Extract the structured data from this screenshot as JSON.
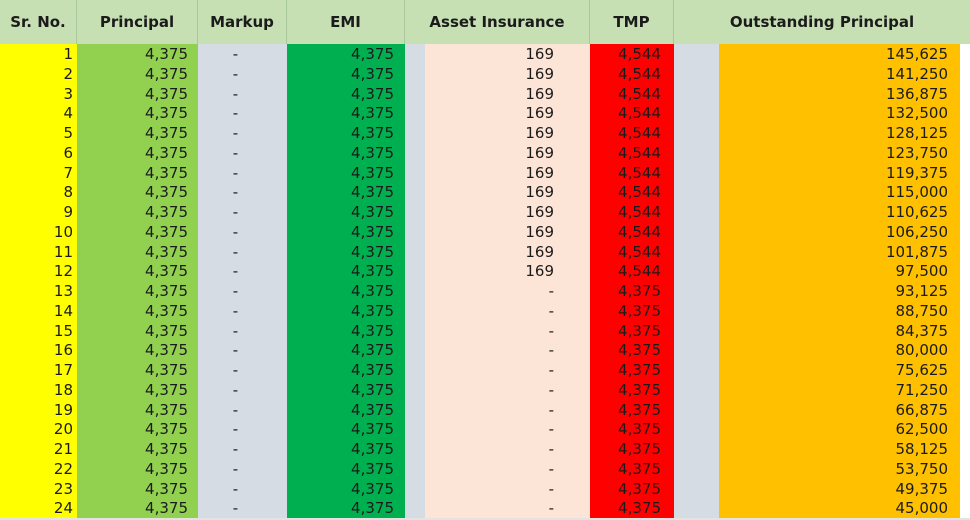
{
  "headers": {
    "sr_no": "Sr. No.",
    "principal": "Principal",
    "markup": "Markup",
    "emi": "EMI",
    "asset_insurance": "Asset Insurance",
    "tmp": "TMP",
    "outstanding_principal": "Outstanding Principal"
  },
  "colors": {
    "header_bg": "#c6e0b4",
    "sr_no_bg": "#ffff00",
    "principal_bg": "#92d050",
    "markup_bg": "#d6dce4",
    "emi_bg": "#00b050",
    "insurance_bg": "#fce4d6",
    "tmp_bg": "#ff0000",
    "outstanding_bg": "#ffc000"
  },
  "rows": [
    {
      "sr": "1",
      "principal": "4,375",
      "markup": "-",
      "emi": "4,375",
      "insurance": "169",
      "tmp": "4,544",
      "outstanding": "145,625"
    },
    {
      "sr": "2",
      "principal": "4,375",
      "markup": "-",
      "emi": "4,375",
      "insurance": "169",
      "tmp": "4,544",
      "outstanding": "141,250"
    },
    {
      "sr": "3",
      "principal": "4,375",
      "markup": "-",
      "emi": "4,375",
      "insurance": "169",
      "tmp": "4,544",
      "outstanding": "136,875"
    },
    {
      "sr": "4",
      "principal": "4,375",
      "markup": "-",
      "emi": "4,375",
      "insurance": "169",
      "tmp": "4,544",
      "outstanding": "132,500"
    },
    {
      "sr": "5",
      "principal": "4,375",
      "markup": "-",
      "emi": "4,375",
      "insurance": "169",
      "tmp": "4,544",
      "outstanding": "128,125"
    },
    {
      "sr": "6",
      "principal": "4,375",
      "markup": "-",
      "emi": "4,375",
      "insurance": "169",
      "tmp": "4,544",
      "outstanding": "123,750"
    },
    {
      "sr": "7",
      "principal": "4,375",
      "markup": "-",
      "emi": "4,375",
      "insurance": "169",
      "tmp": "4,544",
      "outstanding": "119,375"
    },
    {
      "sr": "8",
      "principal": "4,375",
      "markup": "-",
      "emi": "4,375",
      "insurance": "169",
      "tmp": "4,544",
      "outstanding": "115,000"
    },
    {
      "sr": "9",
      "principal": "4,375",
      "markup": "-",
      "emi": "4,375",
      "insurance": "169",
      "tmp": "4,544",
      "outstanding": "110,625"
    },
    {
      "sr": "10",
      "principal": "4,375",
      "markup": "-",
      "emi": "4,375",
      "insurance": "169",
      "tmp": "4,544",
      "outstanding": "106,250"
    },
    {
      "sr": "11",
      "principal": "4,375",
      "markup": "-",
      "emi": "4,375",
      "insurance": "169",
      "tmp": "4,544",
      "outstanding": "101,875"
    },
    {
      "sr": "12",
      "principal": "4,375",
      "markup": "-",
      "emi": "4,375",
      "insurance": "169",
      "tmp": "4,544",
      "outstanding": "97,500"
    },
    {
      "sr": "13",
      "principal": "4,375",
      "markup": "-",
      "emi": "4,375",
      "insurance": "-",
      "tmp": "4,375",
      "outstanding": "93,125"
    },
    {
      "sr": "14",
      "principal": "4,375",
      "markup": "-",
      "emi": "4,375",
      "insurance": "-",
      "tmp": "4,375",
      "outstanding": "88,750"
    },
    {
      "sr": "15",
      "principal": "4,375",
      "markup": "-",
      "emi": "4,375",
      "insurance": "-",
      "tmp": "4,375",
      "outstanding": "84,375"
    },
    {
      "sr": "16",
      "principal": "4,375",
      "markup": "-",
      "emi": "4,375",
      "insurance": "-",
      "tmp": "4,375",
      "outstanding": "80,000"
    },
    {
      "sr": "17",
      "principal": "4,375",
      "markup": "-",
      "emi": "4,375",
      "insurance": "-",
      "tmp": "4,375",
      "outstanding": "75,625"
    },
    {
      "sr": "18",
      "principal": "4,375",
      "markup": "-",
      "emi": "4,375",
      "insurance": "-",
      "tmp": "4,375",
      "outstanding": "71,250"
    },
    {
      "sr": "19",
      "principal": "4,375",
      "markup": "-",
      "emi": "4,375",
      "insurance": "-",
      "tmp": "4,375",
      "outstanding": "66,875"
    },
    {
      "sr": "20",
      "principal": "4,375",
      "markup": "-",
      "emi": "4,375",
      "insurance": "-",
      "tmp": "4,375",
      "outstanding": "62,500"
    },
    {
      "sr": "21",
      "principal": "4,375",
      "markup": "-",
      "emi": "4,375",
      "insurance": "-",
      "tmp": "4,375",
      "outstanding": "58,125"
    },
    {
      "sr": "22",
      "principal": "4,375",
      "markup": "-",
      "emi": "4,375",
      "insurance": "-",
      "tmp": "4,375",
      "outstanding": "53,750"
    },
    {
      "sr": "23",
      "principal": "4,375",
      "markup": "-",
      "emi": "4,375",
      "insurance": "-",
      "tmp": "4,375",
      "outstanding": "49,375"
    },
    {
      "sr": "24",
      "principal": "4,375",
      "markup": "-",
      "emi": "4,375",
      "insurance": "-",
      "tmp": "4,375",
      "outstanding": "45,000"
    }
  ]
}
